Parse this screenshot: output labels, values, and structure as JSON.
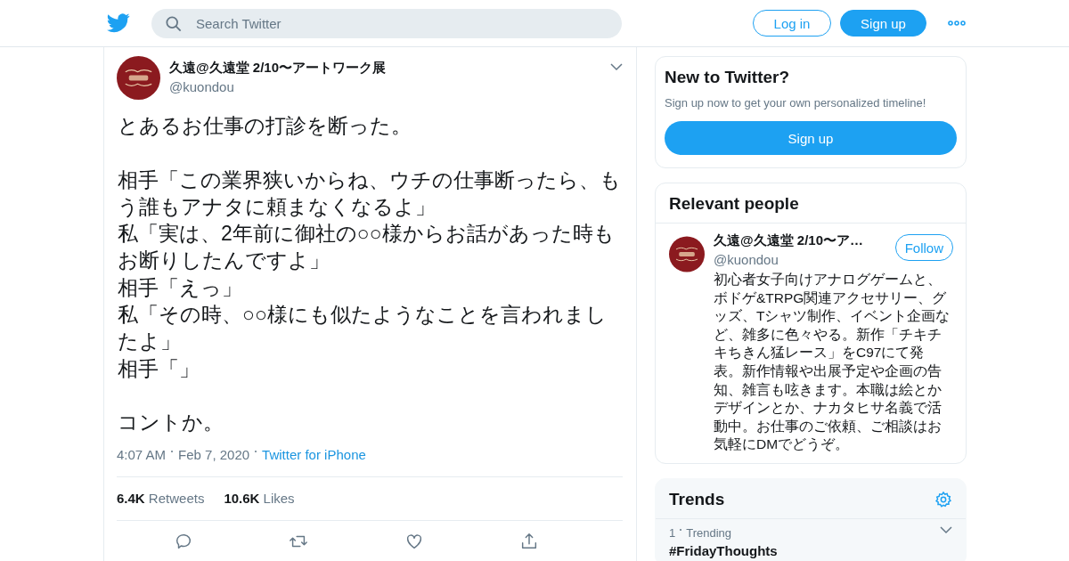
{
  "header": {
    "search": {
      "placeholder": "Search Twitter"
    },
    "buttons": [
      {
        "label": "Log in",
        "kind": "outline"
      },
      {
        "label": "Sign up",
        "kind": "filled"
      }
    ]
  },
  "tweet": {
    "name": "久遠@久遠堂 2/10〜アートワーク展",
    "handle": "@kuondou",
    "paragraphs": [
      [
        "とあるお仕事の打診を断った。"
      ],
      [
        "相手「この業界狭いからね、ウチの仕事断ったら、もう誰もアナタに頼まなくなるよ」",
        "私「実は、2年前に御社の○○様からお話があった時もお断りしたんですよ」",
        "相手「えっ」",
        "私「その時、○○様にも似たようなことを言われましたよ」",
        "相手「」"
      ],
      [
        "コントか。"
      ]
    ],
    "time": "4:07 AM",
    "date": "Feb 7, 2020",
    "source": "Twitter for iPhone",
    "stats": [
      {
        "count": "6.4K",
        "label": "Retweets"
      },
      {
        "count": "10.6K",
        "label": "Likes"
      }
    ],
    "actions": [
      {
        "kind": "reply"
      },
      {
        "kind": "retweet"
      },
      {
        "kind": "like"
      },
      {
        "kind": "share"
      }
    ]
  },
  "signup_card": {
    "title": "New to Twitter?",
    "text": "Sign up now to get your own personalized timeline!",
    "button": "Sign up"
  },
  "relevant_people": {
    "title": "Relevant people",
    "people": [
      {
        "name": "久遠@久遠堂 2/10〜ア…",
        "handle": "@kuondou",
        "button": "Follow",
        "bio": "初心者女子向けアナログゲームと、ボドゲ&TRPG関連アクセサリー、グッズ、Tシャツ制作、イベント企画など、雑多に色々やる。新作「チキチキちきん猛レース」をC97にて発表。新作情報や出展予定や企画の告知、雑言も呟きます。本職は絵とかデザインとか、ナカタヒサ名義で活動中。お仕事のご依頼、ご相談はお気軽にDMでどうぞ。"
      }
    ]
  },
  "trends": {
    "title": "Trends",
    "items": [
      {
        "rank": "1",
        "context": "Trending",
        "name": "#FridayThoughts"
      }
    ]
  }
}
